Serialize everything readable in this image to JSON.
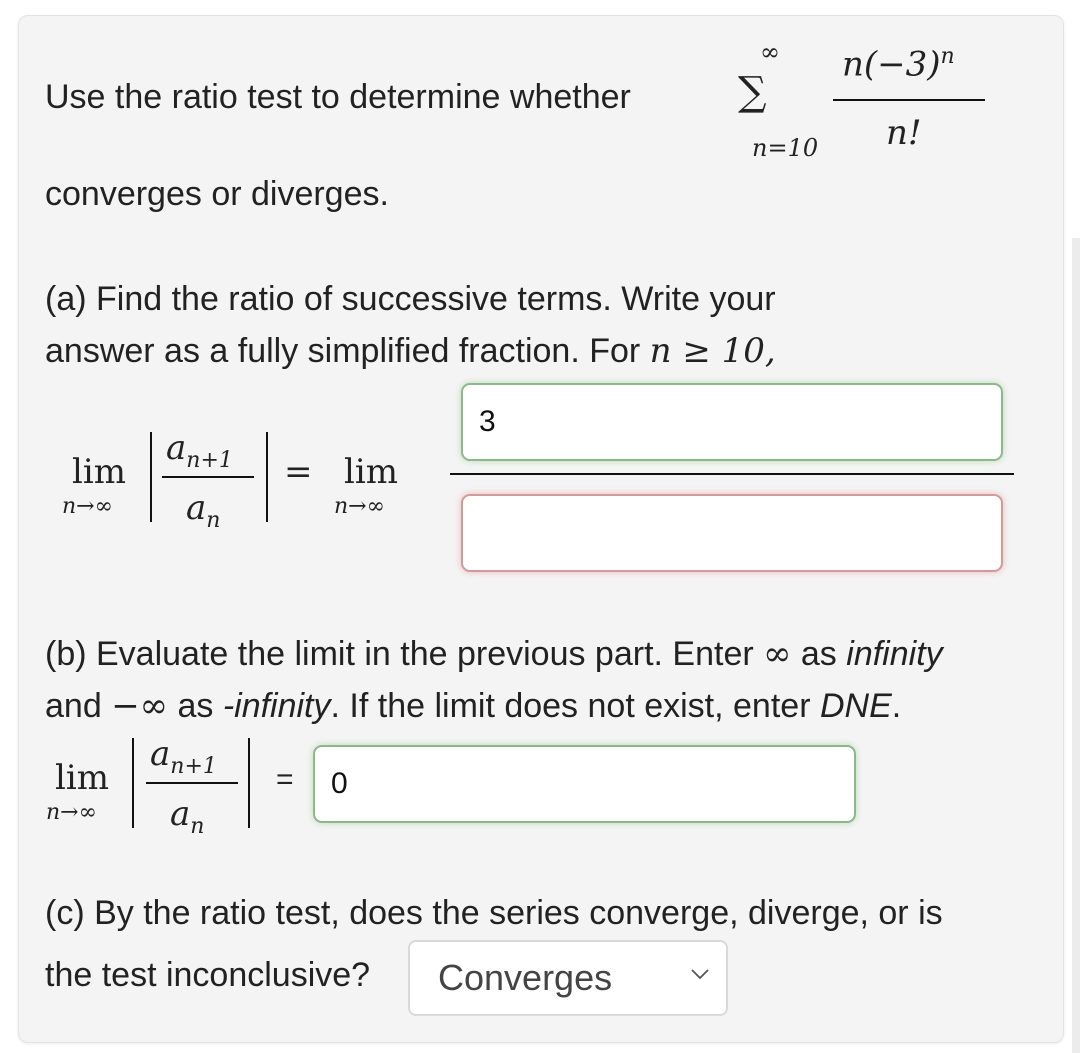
{
  "question": {
    "intro": "Use the ratio test to determine whether",
    "series": {
      "sigma": "∑",
      "upper": "∞",
      "lower": "n=10",
      "numerator_base": "n(−3)",
      "numerator_exp": "n",
      "denominator": "n!"
    },
    "intro_tail": "converges or diverges."
  },
  "part_a": {
    "line1": "(a) Find the ratio of successive terms. Write your",
    "line2_text": "answer as a fully simplified fraction. For ",
    "line2_math": "n ≥ 10,",
    "lim": "lim",
    "lim_sub": "n→∞",
    "ratio_num": "a",
    "ratio_num_sub": "n+1",
    "ratio_den": "a",
    "ratio_den_sub": "n",
    "equals": "=",
    "numerator_input": {
      "value": "3",
      "status": "correct"
    },
    "denominator_input": {
      "value": "",
      "status": "incorrect"
    }
  },
  "part_b": {
    "line1_prefix": "(b) Evaluate the limit in the previous part. Enter ",
    "line1_inf": "∞",
    "line1_as": " as ",
    "line1_infinity": "infinity",
    "line2_and": "and ",
    "line2_neginf": "−∞",
    "line2_as": " as ",
    "line2_neginfinity": "-infinity",
    "line2_mid": ". If the limit does not exist, enter ",
    "line2_dne": "DNE",
    "line2_end": ".",
    "lim": "lim",
    "lim_sub": "n→∞",
    "ratio_num": "a",
    "ratio_num_sub": "n+1",
    "ratio_den": "a",
    "ratio_den_sub": "n",
    "equals": "=",
    "answer_input": {
      "value": "0",
      "status": "correct"
    }
  },
  "part_c": {
    "line1": "(c) By the ratio test, does the series converge, diverge, or is",
    "line2": "the test inconclusive?",
    "select": {
      "selected": "Converges",
      "icon": "chevron-down-icon"
    }
  },
  "colors": {
    "correct_border": "#8cb88a",
    "incorrect_border": "#d39a9a",
    "panel_bg": "#f4f4f4"
  }
}
